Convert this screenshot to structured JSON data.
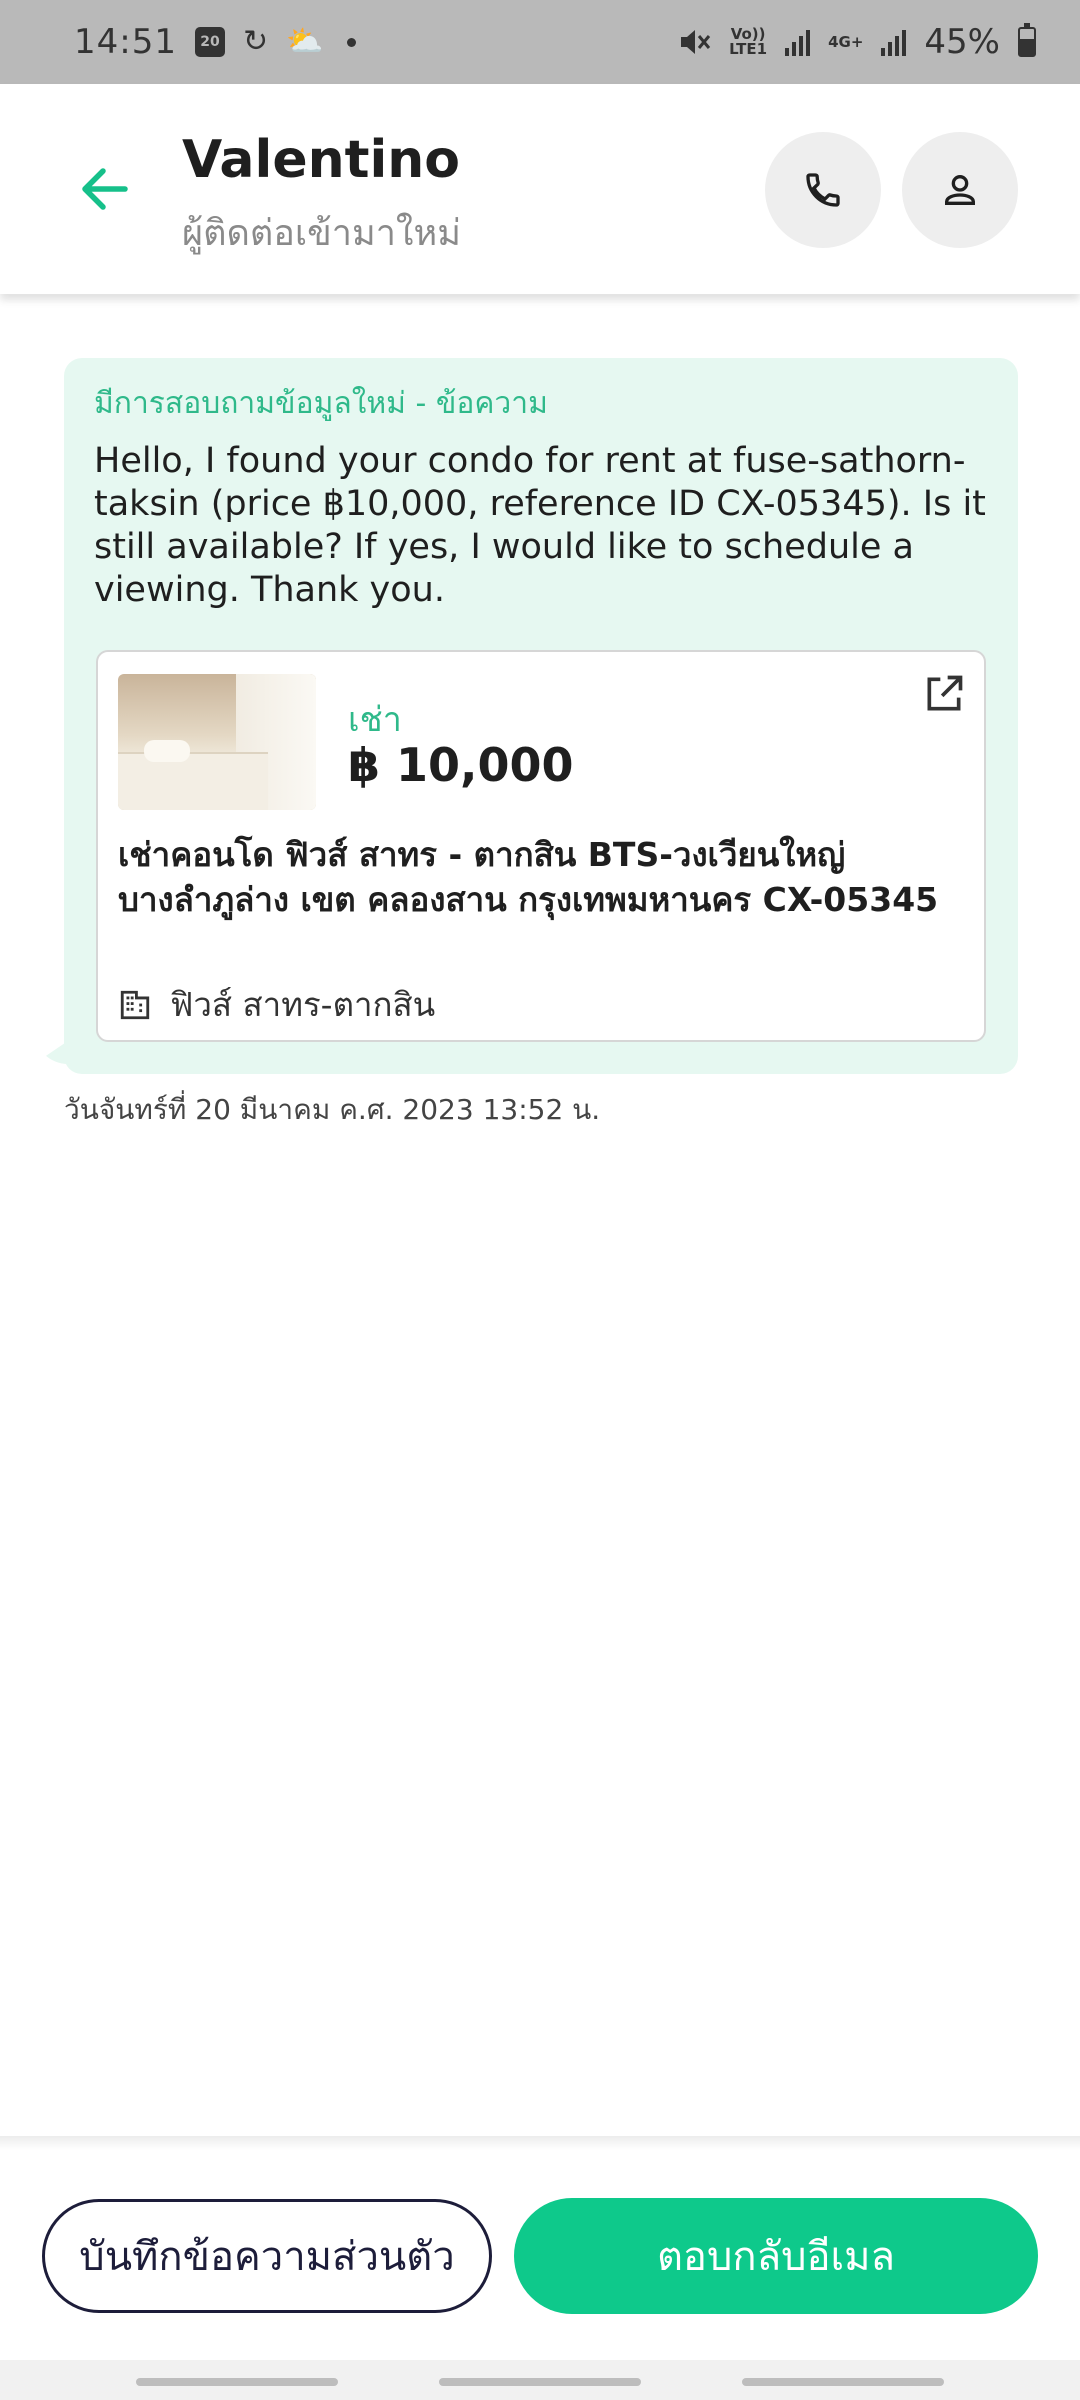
{
  "status_bar": {
    "time": "14:51",
    "calendar_day": "20",
    "network_volte": "Vo))",
    "network_lte": "LTE1",
    "network_4g": "4G+",
    "battery_percent": "45%"
  },
  "header": {
    "contact_name": "Valentino",
    "contact_status": "ผู้ติดต่อเข้ามาใหม่"
  },
  "message": {
    "label": "มีการสอบถามข้อมูลใหม่ - ข้อความ",
    "text": "Hello, I found your condo for rent at fuse-sathorn-taksin (price ฿10,000, reference ID CX-05345). Is it still available? If yes, I would like to schedule a viewing. Thank you.",
    "timestamp": "วันจันทร์ที่ 20 มีนาคม ค.ศ. 2023 13:52 น."
  },
  "listing": {
    "type": "เช่า",
    "price": "฿ 10,000",
    "title": "เช่าคอนโด ฟิวส์ สาทร - ตากสิน  BTS-วงเวียนใหญ่ บางลำภูล่าง เขต คลองสาน กรุงเทพมหานคร CX-05345",
    "project": "ฟิวส์ สาทร-ตากสิน"
  },
  "actions": {
    "note_label": "บันทึกข้อความส่วนตัว",
    "reply_label": "ตอบกลับอีเมล"
  },
  "colors": {
    "accent": "#0ec98b",
    "accent_text": "#2fb98a",
    "bubble_bg": "#e6f8f1",
    "note_border": "#1d1d3a"
  },
  "icons": {
    "back": "arrow-left-icon",
    "call": "phone-icon",
    "profile": "person-icon",
    "open": "open-external-icon",
    "project": "building-icon"
  }
}
